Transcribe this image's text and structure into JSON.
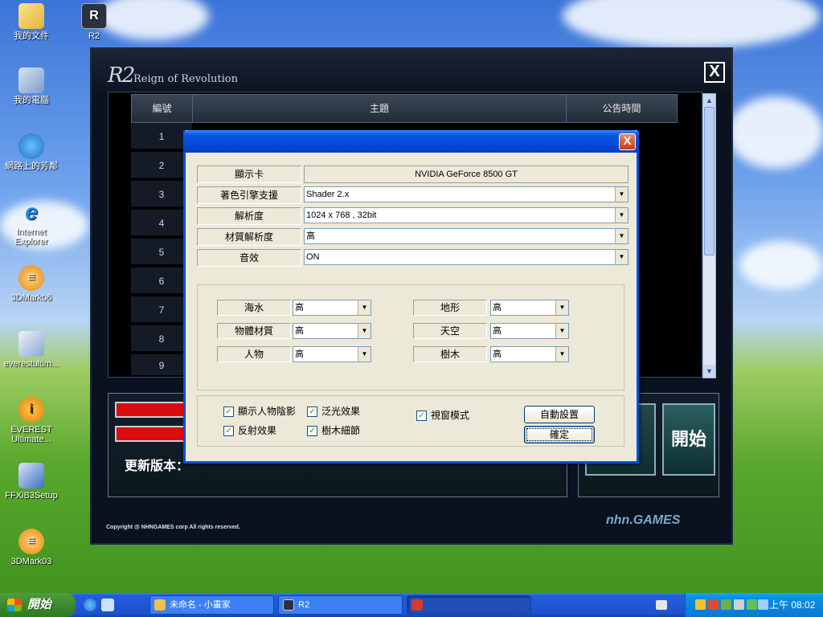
{
  "desktop": {
    "icons": [
      {
        "label": "我的文件",
        "icon": "folder-icon"
      },
      {
        "label": "R2",
        "icon": "r2-app-icon"
      },
      {
        "label": "我的電腦",
        "icon": "computer-icon"
      },
      {
        "label": "網路上的芳鄰",
        "icon": "network-icon"
      },
      {
        "label": "Internet Explorer",
        "icon": "ie-icon"
      },
      {
        "label": "3DMark06",
        "icon": "3dmark-icon"
      },
      {
        "label": "everestultim...",
        "icon": "installer-icon"
      },
      {
        "label": "EVEREST Ultimate...",
        "icon": "everest-icon"
      },
      {
        "label": "FFXiB3Setup",
        "icon": "setup-icon"
      },
      {
        "label": "3DMark03",
        "icon": "3dmark-icon"
      }
    ]
  },
  "launcher": {
    "logo": "R2",
    "title": "Reign of Revolution",
    "close_label": "X",
    "table": {
      "columns": [
        "編號",
        "主題",
        "公告時間"
      ],
      "rows": [
        "1",
        "2",
        "3",
        "4",
        "5",
        "6",
        "7",
        "8",
        "9"
      ]
    },
    "update_label": "更新版本：",
    "start_label": "開始",
    "copyright": "Copyright @ NHNGAMES corp All rights reserved.",
    "brand": "nhn.GAMES"
  },
  "dialog": {
    "close_label": "X",
    "settings": [
      {
        "label": "顯示卡",
        "value": "NVIDIA GeForce 8500 GT",
        "type": "static"
      },
      {
        "label": "著色引擎支援",
        "value": "Shader 2.x",
        "type": "combo"
      },
      {
        "label": "解析度",
        "value": "1024 x 768 , 32bit",
        "type": "combo"
      },
      {
        "label": "材質解析度",
        "value": "高",
        "type": "combo"
      },
      {
        "label": "音效",
        "value": "ON",
        "type": "combo"
      }
    ],
    "quality_left": [
      {
        "label": "海水",
        "value": "高"
      },
      {
        "label": "物體材質",
        "value": "高"
      },
      {
        "label": "人物",
        "value": "高"
      }
    ],
    "quality_right": [
      {
        "label": "地形",
        "value": "高"
      },
      {
        "label": "天空",
        "value": "高"
      },
      {
        "label": "樹木",
        "value": "高"
      }
    ],
    "checkboxes": [
      {
        "label": "顯示人物陰影",
        "checked": true
      },
      {
        "label": "泛光效果",
        "checked": true
      },
      {
        "label": "反射效果",
        "checked": true
      },
      {
        "label": "樹木細節",
        "checked": true
      },
      {
        "label": "視窗模式",
        "checked": true
      }
    ],
    "auto_button": "自動設置",
    "ok_button": "確定"
  },
  "taskbar": {
    "start_label": "開始",
    "tasks": [
      {
        "label": "未命名 - 小畫家",
        "icon": "paint-icon"
      },
      {
        "label": "R2",
        "icon": "r2-app-icon"
      },
      {
        "label": "",
        "icon": "launcher-icon"
      }
    ],
    "clock": "上午 08:02"
  }
}
